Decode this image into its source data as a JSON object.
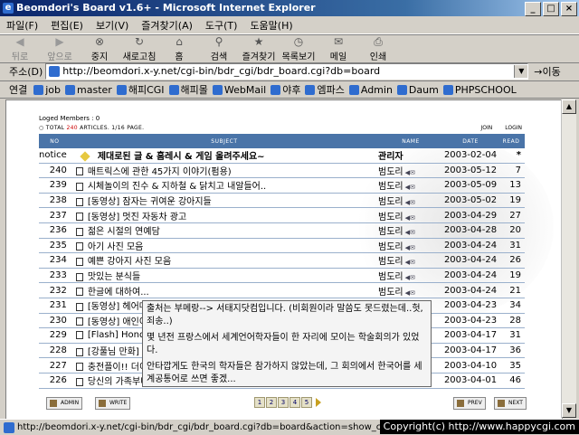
{
  "window": {
    "title": "Beomdori's Board v1.6+ - Microsoft Internet Explorer"
  },
  "menu": [
    "파일(F)",
    "편집(E)",
    "보기(V)",
    "즐겨찾기(A)",
    "도구(T)",
    "도움말(H)"
  ],
  "toolbar": [
    {
      "label": "뒤로",
      "icon": "back-arrow-icon",
      "enabled": false
    },
    {
      "label": "앞으로",
      "icon": "forward-arrow-icon",
      "enabled": false
    },
    {
      "label": "중지",
      "icon": "stop-icon",
      "enabled": true
    },
    {
      "label": "새로고침",
      "icon": "refresh-icon",
      "enabled": true
    },
    {
      "label": "홈",
      "icon": "home-icon",
      "enabled": true
    },
    {
      "label": "검색",
      "icon": "search-icon",
      "enabled": true
    },
    {
      "label": "즐겨찾기",
      "icon": "favorites-icon",
      "enabled": true
    },
    {
      "label": "목록보기",
      "icon": "history-icon",
      "enabled": true
    },
    {
      "label": "메일",
      "icon": "mail-icon",
      "enabled": true
    },
    {
      "label": "인쇄",
      "icon": "print-icon",
      "enabled": true
    }
  ],
  "address": {
    "label": "주소(D)",
    "value": "http://beomdori.x-y.net/cgi-bin/bdr_cgi/bdr_board.cgi?db=board",
    "go": "이동"
  },
  "links": {
    "label": "연결",
    "items": [
      "job",
      "master",
      "해피CGI",
      "해피몰",
      "WebMail",
      "야후",
      "엠파스",
      "Admin",
      "Daum",
      "PHPSCHOOL"
    ]
  },
  "board": {
    "loged": "Loged Members : 0",
    "total_prefix": "TOTAL",
    "total_count": "240",
    "total_suffix": "ARTICLES.  1/16 PAGE.",
    "join": "JOIN",
    "login": "LOGIN",
    "headers": {
      "no": "NO",
      "subject": "SUBJECT",
      "name": "NAME",
      "date": "DATE",
      "read": "READ"
    },
    "notice": {
      "no": "notice",
      "subject": "제대로된 글 & 홈레시 & 게임 올려주세요~",
      "name": "관리자",
      "date": "2003-02-04",
      "read": "*"
    },
    "rows": [
      {
        "no": "240",
        "subject": "매트릭스에 관한 45가지 이야기(펌용)",
        "name": "범도리",
        "date": "2003-05-12",
        "read": "7"
      },
      {
        "no": "239",
        "subject": "시체놀이의 진수 & 지하철 & 닭치고 내알들어..",
        "name": "범도리",
        "date": "2003-05-09",
        "read": "13"
      },
      {
        "no": "238",
        "subject": "[동영상] 잠자는 귀여운 강아지들",
        "name": "범도리",
        "date": "2003-05-02",
        "read": "19"
      },
      {
        "no": "237",
        "subject": "[동영상] 멋진 자동차 광고",
        "name": "범도리",
        "date": "2003-04-29",
        "read": "27"
      },
      {
        "no": "236",
        "subject": "젊은 시절의 연예담",
        "name": "범도리",
        "date": "2003-04-28",
        "read": "20"
      },
      {
        "no": "235",
        "subject": "아기 사진 모음",
        "name": "범도리",
        "date": "2003-04-24",
        "read": "31"
      },
      {
        "no": "234",
        "subject": "예쁜 강아지 사진 모음",
        "name": "범도리",
        "date": "2003-04-24",
        "read": "26"
      },
      {
        "no": "233",
        "subject": "맛있는 분식들",
        "name": "범도리",
        "date": "2003-04-24",
        "read": "19"
      },
      {
        "no": "232",
        "subject": "한글에 대하여...",
        "name": "범도리",
        "date": "2003-04-24",
        "read": "21"
      },
      {
        "no": "231",
        "subject": "[동영상] 헤어메이",
        "name": "범도리",
        "date": "2003-04-23",
        "read": "34"
      },
      {
        "no": "230",
        "subject": "[동영상] 애인이",
        "name": "범도리",
        "date": "2003-04-23",
        "read": "28"
      },
      {
        "no": "229",
        "subject": "[Flash] Honda Ac",
        "name": "범도리",
        "date": "2003-04-17",
        "read": "31"
      },
      {
        "no": "228",
        "subject": "[강풀님 만화] 신",
        "name": "범도리",
        "date": "2003-04-17",
        "read": "36"
      },
      {
        "no": "227",
        "subject": "충전플이!! 더이상",
        "name": "범도리",
        "date": "2003-04-10",
        "read": "35"
      },
      {
        "no": "226",
        "subject": "당신의 가족부터",
        "name": "범도리",
        "date": "2003-04-01",
        "read": "46"
      }
    ],
    "tooltip": [
      "출처는 부메랑--> 서태지닷컴입니다. (비회원이라 말씀도 못드렸는데..헛, 죄송..)",
      "몇 년전 프랑스에서 세계언어학자들이 한 자리에 모이는 학술회의가 있었다.",
      "안타깝게도 한국의 학자들은 참가하지 않았는데, 그 회의에서 한국어를 세계공통어로 쓰면 좋겠..."
    ],
    "buttons": {
      "admin": "ADMIN",
      "write": "WRITE",
      "prev": "PREV",
      "next": "NEXT"
    },
    "pages": [
      "1",
      "2",
      "3",
      "4",
      "5"
    ]
  },
  "status": {
    "url": "http://beomdori.x-y.net/cgi-bin/bdr_cgi/bdr_board.cgi?db=board&action=show_content&n=",
    "copyright": "Copyright(c) http://www.happycgi.com"
  }
}
